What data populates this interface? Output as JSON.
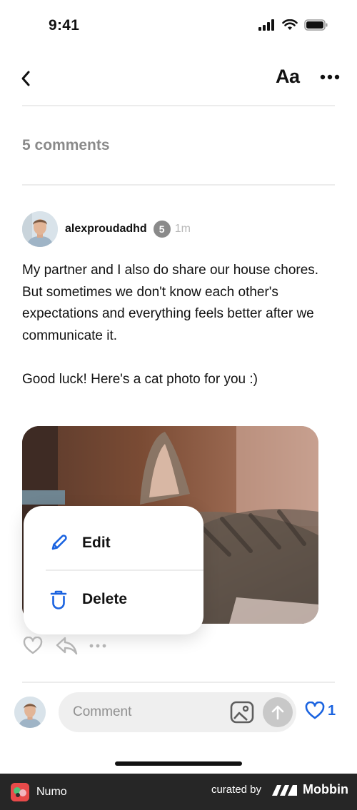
{
  "status": {
    "time": "9:41"
  },
  "nav": {
    "font_label": "Aa"
  },
  "comments": {
    "count_label": "5 comments"
  },
  "comment": {
    "username": "alexproudadhd",
    "badge": "5",
    "time": "1m",
    "paragraphs": [
      "My partner and I also do share our house chores. But sometimes we don't know each other's expectations and everything feels better after we communicate it.",
      "Good luck! Here's a cat photo for you :)"
    ]
  },
  "menu": {
    "edit_label": "Edit",
    "delete_label": "Delete"
  },
  "composer": {
    "placeholder": "Comment",
    "like_count": "1"
  },
  "footer": {
    "app_name": "Numo",
    "curated_by": "curated by",
    "brand": "Mobbin"
  },
  "colors": {
    "accent": "#1a63e0",
    "footer_bg": "#262626",
    "muted": "#8a8a8a"
  },
  "icons": [
    "signal-icon",
    "wifi-icon",
    "battery-icon",
    "back-chevron-icon",
    "more-dots-icon",
    "pencil-icon",
    "trash-icon",
    "heart-icon",
    "reply-icon",
    "image-icon",
    "send-arrow-icon",
    "mobbin-logo-icon"
  ]
}
